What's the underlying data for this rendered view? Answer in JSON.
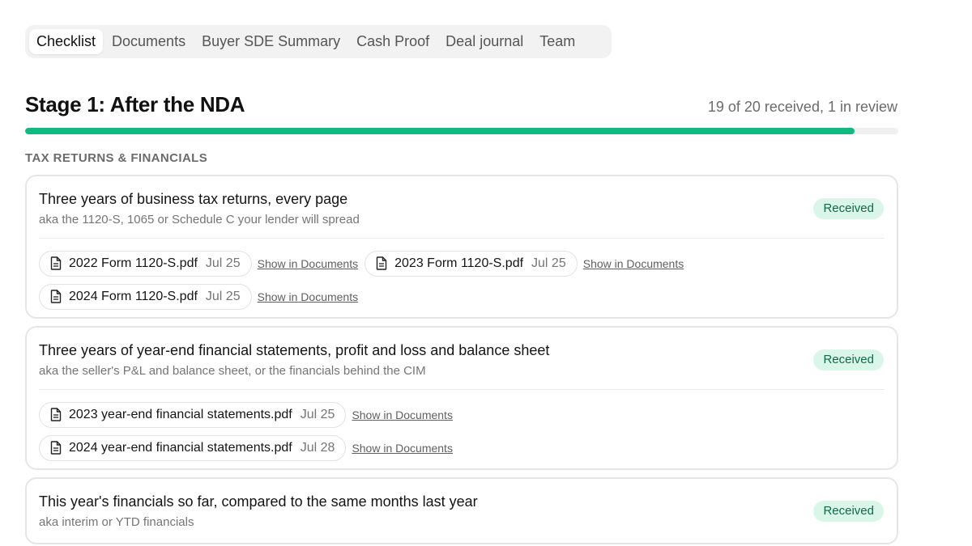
{
  "tabs": [
    {
      "label": "Checklist"
    },
    {
      "label": "Documents"
    },
    {
      "label": "Buyer SDE Summary"
    },
    {
      "label": "Cash Proof"
    },
    {
      "label": "Deal journal"
    },
    {
      "label": "Team"
    }
  ],
  "stage": {
    "title": "Stage 1: After the NDA",
    "status": "19 of 20 received, 1 in review",
    "progress_fraction": 0.95
  },
  "section": {
    "label": "TAX RETURNS & FINANCIALS"
  },
  "colors": {
    "accent_green": "#12b981",
    "badge_bg": "#d9f6e8",
    "badge_text": "#0f6a45"
  },
  "icons": {
    "file": "document-icon"
  },
  "items": [
    {
      "title": "Three years of business tax returns, every page",
      "aka": "aka the 1120-S, 1065 or Schedule C your lender will spread",
      "status": "Received",
      "files": [
        {
          "name": "2022 Form 1120-S.pdf",
          "date": "Jul 25",
          "link": "Show in Documents"
        },
        {
          "name": "2023 Form 1120-S.pdf",
          "date": "Jul 25",
          "link": "Show in Documents"
        },
        {
          "name": "2024 Form 1120-S.pdf",
          "date": "Jul 25",
          "link": "Show in Documents"
        }
      ]
    },
    {
      "title": "Three years of year-end financial statements, profit and loss and balance sheet",
      "aka": "aka the seller's P&L and balance sheet, or the financials behind the CIM",
      "status": "Received",
      "files": [
        {
          "name": "2023 year-end financial statements.pdf",
          "date": "Jul 25",
          "link": "Show in Documents"
        },
        {
          "name": "2024 year-end financial statements.pdf",
          "date": "Jul 28",
          "link": "Show in Documents"
        }
      ]
    },
    {
      "title": "This year's financials so far, compared to the same months last year",
      "aka": "aka interim or YTD financials",
      "status": "Received",
      "files": []
    }
  ]
}
